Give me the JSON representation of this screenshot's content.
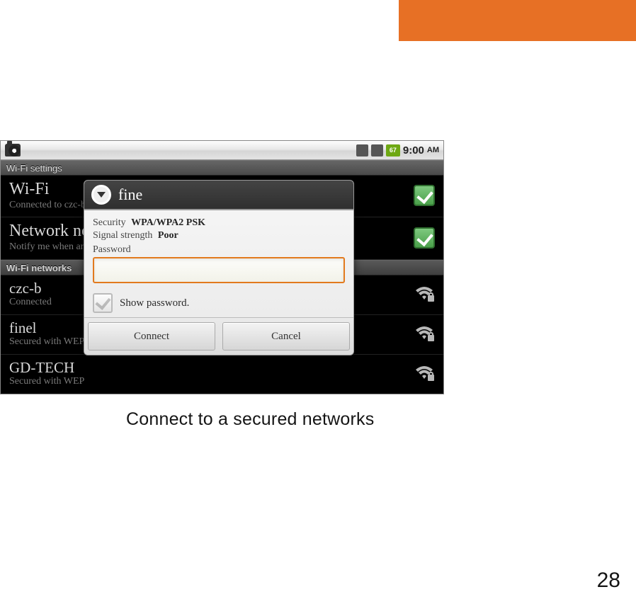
{
  "header_color": "#e77025",
  "status": {
    "battery": "67",
    "time": "9:00",
    "meridiem": "AM"
  },
  "subbar": "Wi-Fi settings",
  "rows": {
    "wifi": {
      "title": "Wi-Fi",
      "sub": "Connected to czc-b"
    },
    "notif": {
      "title": "Network not",
      "sub": "Notify me when an"
    }
  },
  "section": "Wi-Fi networks",
  "networks": [
    {
      "name": "czc-b",
      "sub": "Connected"
    },
    {
      "name": "finel",
      "sub": "Secured with WEP"
    },
    {
      "name": "GD-TECH",
      "sub": "Secured with WEP"
    }
  ],
  "dialog": {
    "title": "fine",
    "security_k": "Security",
    "security_v": "WPA/WPA2 PSK",
    "signal_k": "Signal strength",
    "signal_v": "Poor",
    "password_label": "Password",
    "show_password": "Show password.",
    "connect": "Connect",
    "cancel": "Cancel"
  },
  "caption": "Connect to a secured networks",
  "page_number": "28"
}
